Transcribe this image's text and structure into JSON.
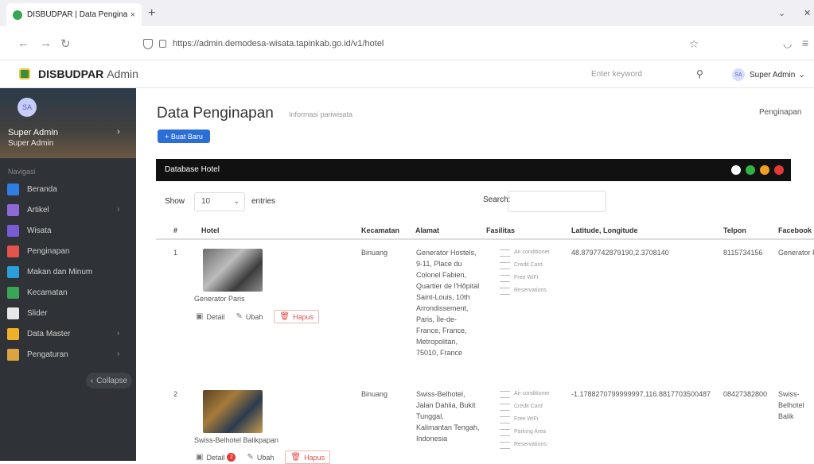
{
  "browser": {
    "tab_title": "DISBUDPAR | Data Penginapan",
    "tab_close": "×",
    "new_tab": "+",
    "url": "https://admin.demodesa-wisata.tapinkab.go.id/v1/hotel"
  },
  "header": {
    "brand_bold": "DISBUDPAR",
    "brand_rest": "Admin",
    "search_placeholder": "Enter keyword",
    "user_initials": "SA",
    "user_name": "Super Admin"
  },
  "sidebar": {
    "initials": "SA",
    "name": "Super Admin",
    "role": "Super Admin",
    "nav_heading": "Navigasi",
    "items": [
      {
        "label": "Beranda",
        "color": "#2f7de1",
        "has_children": false
      },
      {
        "label": "Artikel",
        "color": "#8e6ad8",
        "has_children": true
      },
      {
        "label": "Wisata",
        "color": "#7a5bd6",
        "has_children": false
      },
      {
        "label": "Penginapan",
        "color": "#e5534b",
        "has_children": false
      },
      {
        "label": "Makan dan Minum",
        "color": "#2b9fd9",
        "has_children": false
      },
      {
        "label": "Kecamatan",
        "color": "#3aa655",
        "has_children": false
      },
      {
        "label": "Slider",
        "color": "#e8e8e8",
        "has_children": false
      },
      {
        "label": "Data Master",
        "color": "#f0b12a",
        "has_children": true
      },
      {
        "label": "Pengaturan",
        "color": "#d9a441",
        "has_children": true
      }
    ],
    "collapse_label": "Collapse"
  },
  "page": {
    "title": "Data Penginapan",
    "subtitle": "Informasi pariwisata",
    "breadcrumb": "Penginapan",
    "add_button": "+ Buat Baru"
  },
  "panel": {
    "title": "Database Hotel",
    "dot_colors": [
      "#ffffff",
      "#2fb344",
      "#f0a020",
      "#e53935"
    ]
  },
  "table": {
    "show_label": "Show",
    "length_value": "10",
    "entries_label": "entries",
    "search_label": "Search:",
    "columns": [
      "#",
      "Hotel",
      "Kecamatan",
      "Alamat",
      "Fasilitas",
      "Latitude, Longitude",
      "Telpon",
      "Facebook"
    ],
    "rows": [
      {
        "no": "1",
        "hotel": "Generator Paris",
        "kecamatan": "Binuang",
        "alamat": "Generator Hostels, 9-11, Place du Colonel Fabien, Quartier de l'Hôpital Saint-Louis, 10th Arrondissement, Paris, Île-de-France, France, Metropolitan, 75010, France",
        "fasilitas": [
          "Air conditioner",
          "Credit Card",
          "Free WiFi",
          "Reservations"
        ],
        "latlng": "48.8797742879190,2.3708140",
        "telpon": "8115734156",
        "facebook": "Generator Paris",
        "badge": ""
      },
      {
        "no": "2",
        "hotel": "Swiss-Belhotel Balikpapan",
        "kecamatan": "Binuang",
        "alamat": "Swiss-Belhotel, Jalan Dahlia, Bukit Tunggal, Kalimantan Tengah, Indonesia",
        "fasilitas": [
          "Air conditioner",
          "Credit Card",
          "Free WiFi",
          "Parking Area",
          "Reservations"
        ],
        "latlng": "-1.1788270799999997,116.8817703500487",
        "telpon": "08427382800",
        "facebook": "Swiss-Belhotel Balik",
        "badge": "2"
      }
    ],
    "actions": {
      "detail": "Detail",
      "ubah": "Ubah",
      "hapus": "Hapus"
    }
  }
}
